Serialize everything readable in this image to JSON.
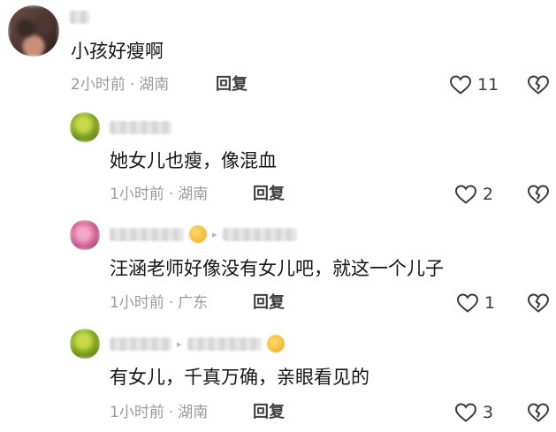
{
  "comments": [
    {
      "text": "小孩好瘦啊",
      "time": "2小时前",
      "location": "湖南",
      "reply": "回复",
      "likes": "11"
    },
    {
      "text": "她女儿也瘦，像混血",
      "time": "1小时前",
      "location": "湖南",
      "reply": "回复",
      "likes": "2"
    },
    {
      "text": "汪涵老师好像没有女儿吧，就这一个儿子",
      "time": "1小时前",
      "location": "广东",
      "reply": "回复",
      "likes": "1"
    },
    {
      "text": "有女儿，千真万确，亲眼看见的",
      "time": "1小时前",
      "location": "湖南",
      "reply": "回复",
      "likes": "3"
    }
  ],
  "meta_separator": "·",
  "icons": {
    "like": "heart-outline-icon",
    "dislike": "broken-heart-icon"
  },
  "colors": {
    "text": "#161616",
    "meta": "#9a9a9a",
    "reply": "#3f3f3f"
  }
}
